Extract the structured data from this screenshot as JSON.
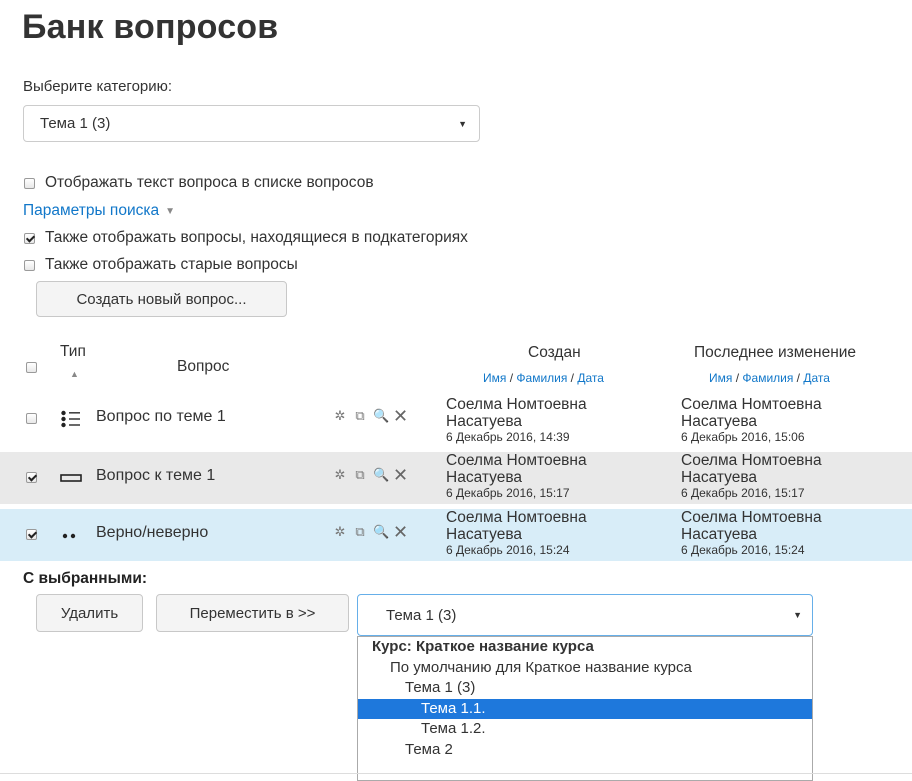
{
  "page": {
    "title": "Банк вопросов"
  },
  "category": {
    "label": "Выберите категорию:",
    "selected": "Тема 1 (3)"
  },
  "options": {
    "show_text": {
      "label": "Отображать текст вопроса в списке вопросов",
      "checked": false
    },
    "search_params": "Параметры поиска",
    "subcats": {
      "label": "Также отображать вопросы, находящиеся в подкатегориях",
      "checked": true
    },
    "old": {
      "label": "Также отображать старые вопросы",
      "checked": false
    }
  },
  "create_button": "Создать новый вопрос...",
  "table": {
    "col_type": "Тип",
    "col_question": "Вопрос",
    "col_created": "Создан",
    "col_modified": "Последнее изменение",
    "sub_name": "Имя",
    "sub_sep": " / ",
    "sub_surname": "Фамилия",
    "sub_date": "Дата",
    "rows": [
      {
        "name": "Вопрос по теме 1",
        "checked": false,
        "icon": "multichoice-icon",
        "created_name": "Соелма Номтоевна",
        "created_surname": "Насатуева",
        "created_date": "6 Декабрь 2016, 14:39",
        "modified_name": "Соелма Номтоевна",
        "modified_surname": "Насатуева",
        "modified_date": "6 Декабрь 2016, 15:06"
      },
      {
        "name": "Вопрос к теме 1",
        "checked": true,
        "icon": "shortanswer-icon",
        "created_name": "Соелма Номтоевна",
        "created_surname": "Насатуева",
        "created_date": "6 Декабрь 2016, 15:17",
        "modified_name": "Соелма Номтоевна",
        "modified_surname": "Насатуева",
        "modified_date": "6 Декабрь 2016, 15:17"
      },
      {
        "name": "Верно/неверно",
        "checked": true,
        "icon": "truefalse-icon",
        "created_name": "Соелма Номтоевна",
        "created_surname": "Насатуева",
        "created_date": "6 Декабрь 2016, 15:24",
        "modified_name": "Соелма Номтоевна",
        "modified_surname": "Насатуева",
        "modified_date": "6 Декабрь 2016, 15:24"
      }
    ]
  },
  "with_selected": {
    "label": "С выбранными:",
    "delete": "Удалить",
    "move": "Переместить в >>",
    "target": "Тема 1 (3)"
  },
  "dropdown": {
    "items": [
      {
        "text": "Курс: Краткое название курса",
        "kind": "group"
      },
      {
        "text": "По умолчанию для Краткое название курса",
        "kind": "item"
      },
      {
        "text": "Тема 1 (3)",
        "kind": "item"
      },
      {
        "text": "Тема 1.1.",
        "kind": "item",
        "selected": true
      },
      {
        "text": "Тема 1.2.",
        "kind": "item"
      },
      {
        "text": "Тема 2",
        "kind": "item"
      }
    ]
  }
}
